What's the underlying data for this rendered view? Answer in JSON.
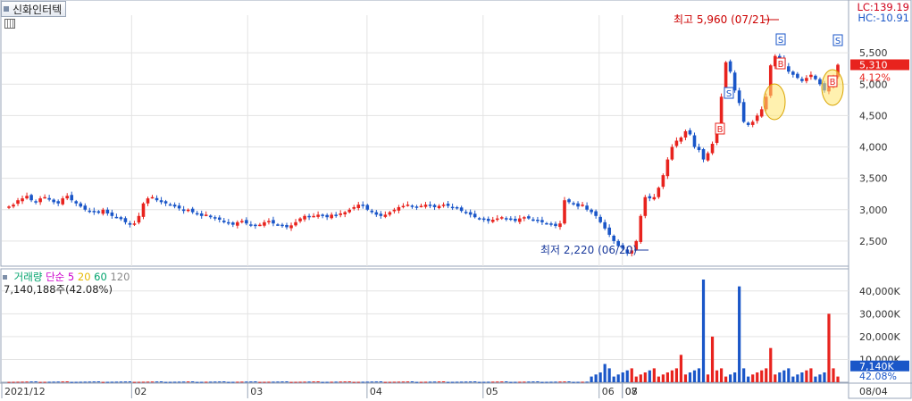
{
  "window": {
    "title": "신화인터텍"
  },
  "header": {
    "lc": "LC:139.19",
    "hc": "HC:-10.91"
  },
  "icons": {
    "calendar": "calendar-icon"
  },
  "colors": {
    "up": "#e8231e",
    "down": "#1a56c8",
    "ma5": "#cc00cc",
    "ma20": "#e6b800",
    "ma60": "#00a36c",
    "ma120": "#888888"
  },
  "volume_panel": {
    "legend": {
      "label": "거래량",
      "ma_label": "단순",
      "p5": "5",
      "p20": "20",
      "p60": "60",
      "p120": "120"
    },
    "info": "7,140,188주(42.08%)"
  },
  "chart_data": [
    {
      "type": "candlestick",
      "title": "신화인터텍",
      "xlabel": "",
      "ylabel": "",
      "ylim": [
        2100,
        6100
      ],
      "y_ticks": [
        "2,500",
        "3,000",
        "3,500",
        "4,000",
        "4,500",
        "5,000",
        "5,500"
      ],
      "x_ticks": [
        "2021/12",
        "02",
        "03",
        "04",
        "05",
        "06",
        "07",
        "08",
        "08/04"
      ],
      "grid": true,
      "annotations": {
        "high": "최고 5,960 (07/21)",
        "low": "최저 2,220 (06/20)"
      },
      "current_price": "5,310",
      "current_change": "4.12%",
      "signals": [
        "S",
        "B",
        "B",
        "S",
        "B",
        "S",
        "B",
        "S",
        "B"
      ],
      "series_note": "daily OHLC approximated from figure",
      "closes": [
        3050,
        3080,
        3150,
        3180,
        3220,
        3150,
        3120,
        3180,
        3200,
        3160,
        3120,
        3100,
        3180,
        3220,
        3150,
        3100,
        3050,
        3000,
        2980,
        2960,
        2950,
        3000,
        2940,
        2900,
        2880,
        2850,
        2800,
        2760,
        2780,
        2900,
        3100,
        3180,
        3200,
        3150,
        3120,
        3100,
        3080,
        3050,
        3020,
        2980,
        3000,
        2960,
        2940,
        2900,
        2920,
        2880,
        2860,
        2840,
        2800,
        2780,
        2760,
        2800,
        2820,
        2780,
        2760,
        2740,
        2760,
        2800,
        2820,
        2780,
        2760,
        2740,
        2720,
        2750,
        2800,
        2860,
        2900,
        2880,
        2900,
        2920,
        2900,
        2880,
        2920,
        2900,
        2940,
        2960,
        3000,
        3040,
        3080,
        3060,
        3000,
        2960,
        2920,
        2900,
        2920,
        2960,
        3000,
        3040,
        3060,
        3080,
        3050,
        3040,
        3060,
        3080,
        3060,
        3040,
        3060,
        3080,
        3060,
        3040,
        3020,
        2980,
        2960,
        2920,
        2880,
        2860,
        2840,
        2820,
        2840,
        2860,
        2880,
        2860,
        2840,
        2820,
        2860,
        2880,
        2860,
        2840,
        2820,
        2800,
        2780,
        2760,
        2740,
        2780,
        3150,
        3120,
        3100,
        3050,
        3080,
        3000,
        2960,
        2900,
        2800,
        2700,
        2600,
        2500,
        2420,
        2380,
        2300,
        2350,
        2500,
        2900,
        3200,
        3180,
        3200,
        3350,
        3550,
        3800,
        4000,
        4100,
        4150,
        4250,
        4200,
        4000,
        3950,
        3800,
        3900,
        4050,
        4300,
        4800,
        5350,
        5200,
        4900,
        4700,
        4400,
        4350,
        4400,
        4500,
        4600,
        4800,
        5300,
        5450,
        5400,
        5300,
        5200,
        5150,
        5100,
        5050,
        5100,
        5150,
        5080,
        5000,
        4900,
        4950,
        5100,
        5310
      ],
      "volume_ylim": [
        0,
        45000
      ],
      "volume_y_ticks": [
        "10,000K",
        "20,000K",
        "30,000K",
        "40,000K"
      ],
      "current_volume": "7,140K",
      "current_volume_pct": "42.08%"
    }
  ]
}
